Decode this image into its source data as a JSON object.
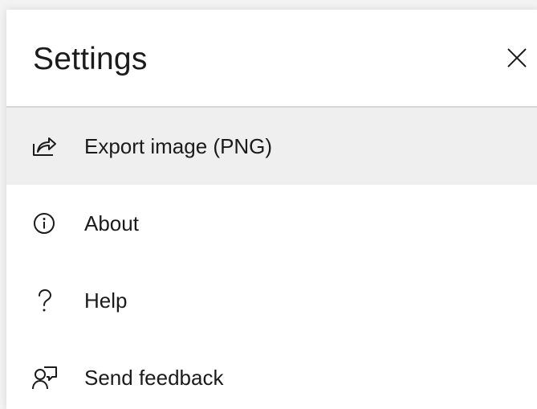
{
  "panel": {
    "title": "Settings",
    "close_icon": "close-icon"
  },
  "menu": {
    "items": [
      {
        "label": "Export image (PNG)",
        "icon": "share-export-icon",
        "active": true
      },
      {
        "label": "About",
        "icon": "info-icon",
        "active": false
      },
      {
        "label": "Help",
        "icon": "question-mark-icon",
        "active": false
      },
      {
        "label": "Send feedback",
        "icon": "feedback-person-icon",
        "active": false
      }
    ]
  },
  "colors": {
    "text": "#1b1b1b",
    "active_background": "#efefef",
    "divider": "#d6d6d6",
    "panel_background": "#ffffff"
  }
}
